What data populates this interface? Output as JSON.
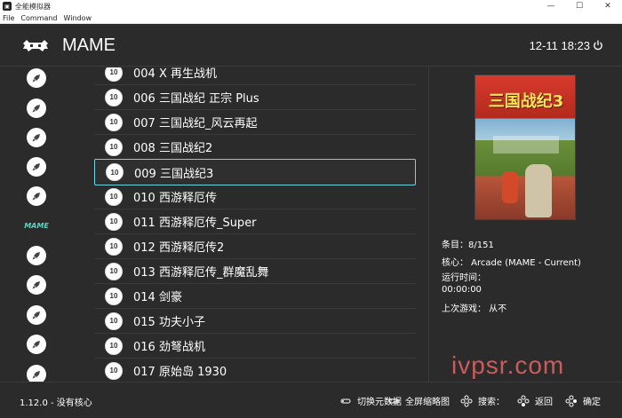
{
  "window": {
    "title": "全能模拟器",
    "minimize": "—",
    "maximize": "☐",
    "close": "✕"
  },
  "menubar": [
    "File",
    "Command",
    "Window"
  ],
  "header": {
    "title": "MAME",
    "clock": "12-11 18:23"
  },
  "sidebar": {
    "items": [
      "rocket-icon",
      "rocket-icon",
      "rocket-icon",
      "rocket-icon",
      "rocket-icon",
      "mame-logo",
      "rocket-icon",
      "rocket-icon",
      "rocket-icon",
      "rocket-icon",
      "rocket-icon",
      "rocket-icon"
    ],
    "mame_label": "MAME"
  },
  "games": [
    {
      "badge": "10",
      "label": "004 X 再生战机"
    },
    {
      "badge": "10",
      "label": "006 三国战纪 正宗 Plus"
    },
    {
      "badge": "10",
      "label": "007 三国战纪_风云再起"
    },
    {
      "badge": "10",
      "label": "008 三国战纪2"
    },
    {
      "badge": "10",
      "label": "009 三国战纪3"
    },
    {
      "badge": "10",
      "label": "010 西游释厄传"
    },
    {
      "badge": "10",
      "label": "011 西游释厄传_Super"
    },
    {
      "badge": "10",
      "label": "012 西游释厄传2"
    },
    {
      "badge": "10",
      "label": "013 西游释厄传_群魔乱舞"
    },
    {
      "badge": "10",
      "label": "014 剑豪"
    },
    {
      "badge": "10",
      "label": "015 功夫小子"
    },
    {
      "badge": "10",
      "label": "016 劲弩战机"
    },
    {
      "badge": "10",
      "label": "017 原始岛 1930"
    }
  ],
  "selected_index": 4,
  "detail": {
    "thumb_title": "三国战纪3",
    "count": "条目：8/151",
    "core": "核心： Arcade (MAME - Current)",
    "runtime": "运行时间： 00:00:00",
    "last_played": "上次游戏： 从不"
  },
  "footer": {
    "version": "1.12.0 - 没有核心",
    "hints": [
      "切换元数据",
      "全屏缩略图",
      "搜索：",
      "返回",
      "确定"
    ]
  },
  "watermark": "ivpsr.com",
  "colors": {
    "background": "#2b2b2b",
    "selection_border": "#6fd3e4",
    "text": "#ffffff"
  }
}
